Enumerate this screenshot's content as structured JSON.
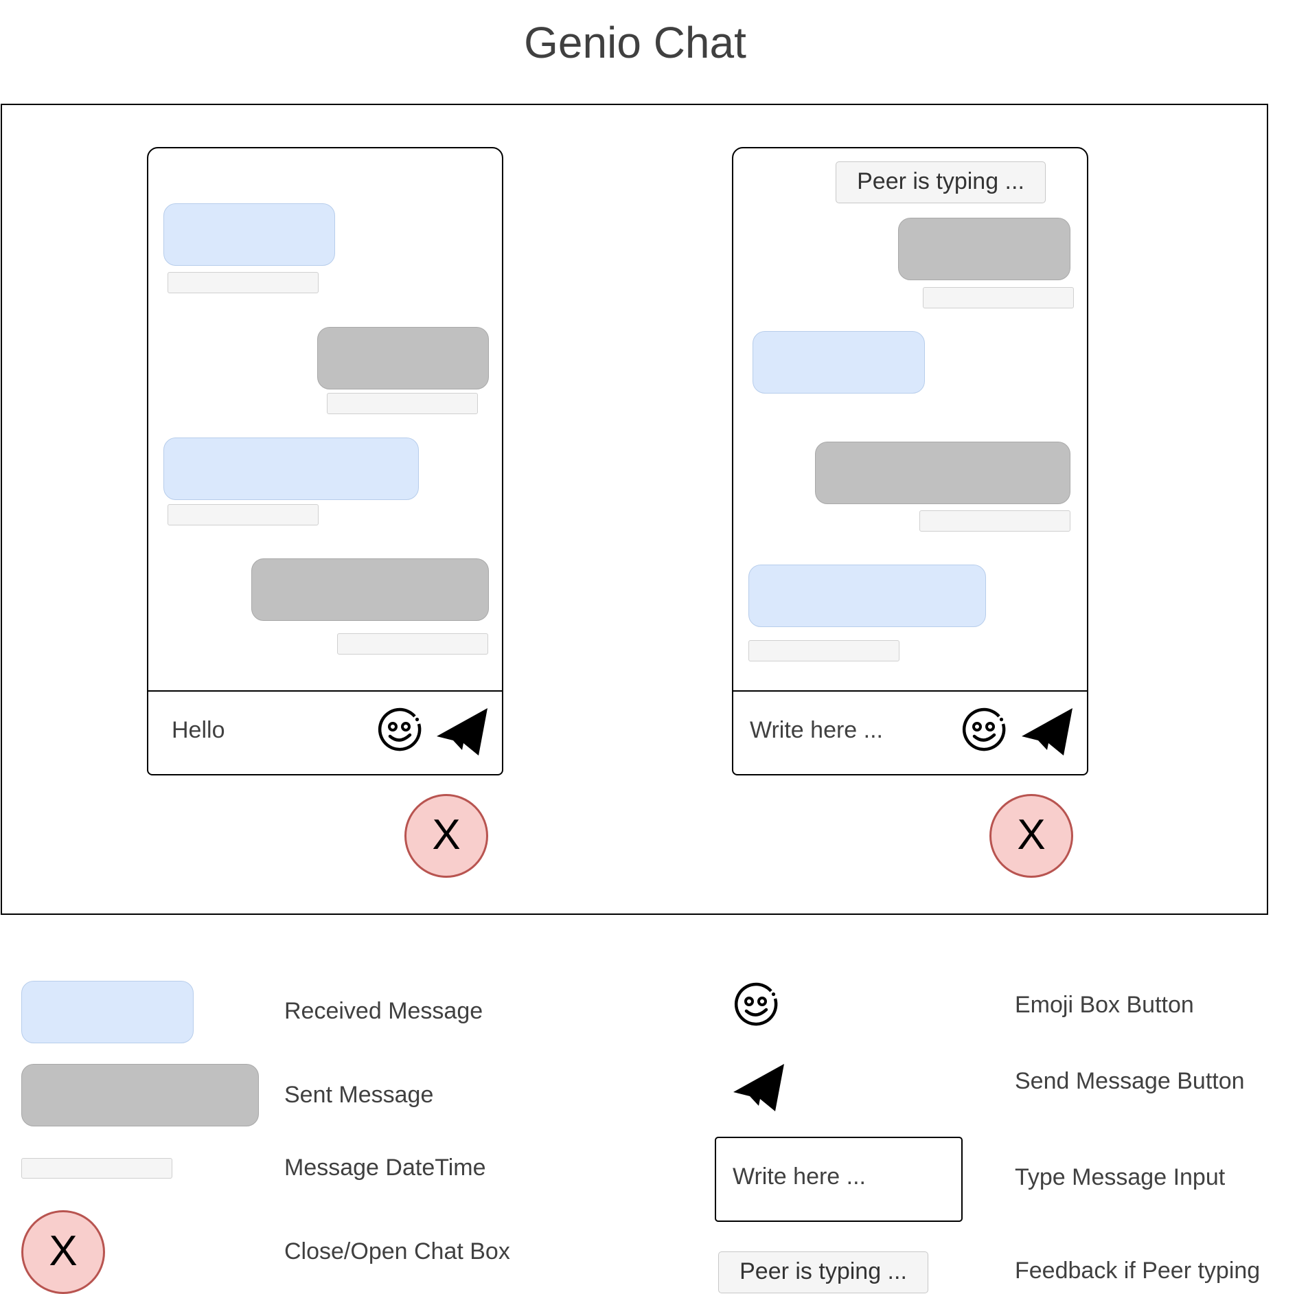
{
  "title": "Genio Chat",
  "chat_left": {
    "input_value": "Hello"
  },
  "chat_right": {
    "typing_indicator": "Peer is typing ...",
    "input_placeholder": "Write here ..."
  },
  "close_label": "X",
  "legend": {
    "received_message": "Received Message",
    "sent_message": "Sent Message",
    "message_datetime": "Message DateTime",
    "close_open_chat_box": "Close/Open Chat Box",
    "emoji_box_button": "Emoji Box Button",
    "send_message_button": "Send Message Button",
    "type_message_input": "Type Message Input",
    "feedback_peer_typing": "Feedback if Peer typing",
    "input_sample": "Write here ...",
    "typing_sample": "Peer is typing ..."
  },
  "colors": {
    "received_fill": "#dae8fc",
    "sent_fill": "#c0c0c0",
    "datetime_fill": "#f5f5f5",
    "close_fill": "#f8cecc",
    "close_stroke": "#b85450"
  }
}
